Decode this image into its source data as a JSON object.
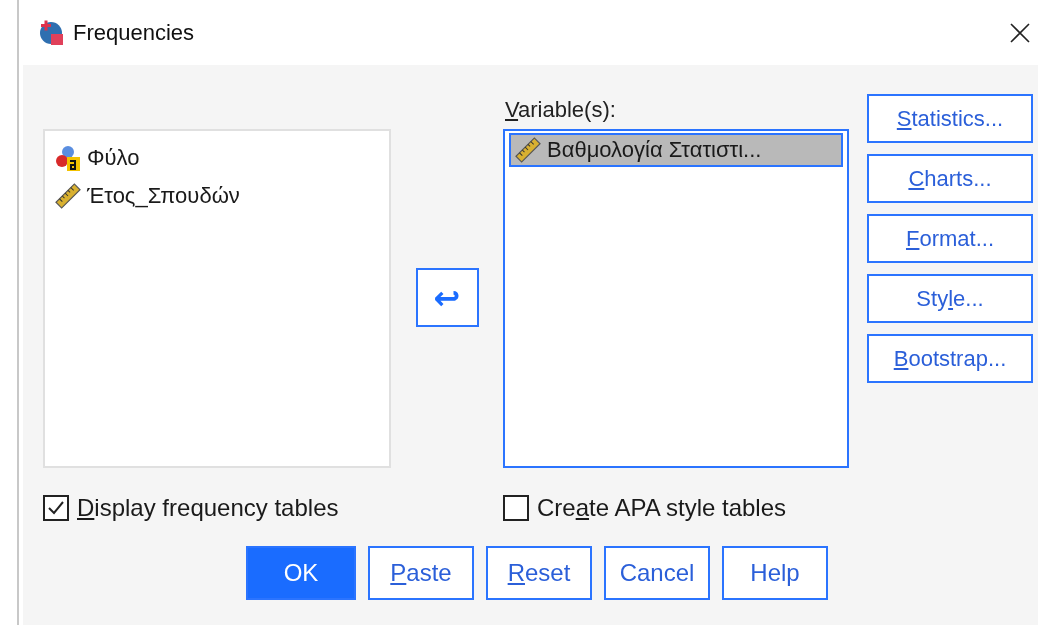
{
  "window": {
    "title": "Frequencies"
  },
  "source_list": {
    "items": [
      {
        "name": "Φύλο",
        "kind": "nominal",
        "selected": false
      },
      {
        "name": "Έτος_Σπουδών",
        "kind": "scale",
        "selected": false
      }
    ]
  },
  "move_button": {
    "symbol": "↩"
  },
  "variables": {
    "label": {
      "key": "V",
      "post": "ariable(s):"
    },
    "items": [
      {
        "name": "Βαθμολογία Στατιστι...",
        "kind": "scale",
        "selected": true
      }
    ]
  },
  "side_buttons": [
    {
      "key": "S",
      "post": "tatistics..."
    },
    {
      "key": "C",
      "post": "harts..."
    },
    {
      "key": "F",
      "post": "ormat..."
    },
    {
      "pre": "Sty",
      "key": "l",
      "post": "e..."
    },
    {
      "key": "B",
      "post": "ootstrap..."
    }
  ],
  "options": [
    {
      "key": "D",
      "post": "isplay frequency tables",
      "checked": true
    },
    {
      "pre": "Cre",
      "key": "a",
      "post": "te APA style tables",
      "checked": false
    }
  ],
  "buttons": [
    {
      "pre": "OK",
      "primary": true
    },
    {
      "key": "P",
      "post": "aste",
      "primary": false
    },
    {
      "key": "R",
      "post": "eset",
      "primary": false
    },
    {
      "pre": "Cancel",
      "primary": false
    },
    {
      "pre": "Help",
      "primary": false
    }
  ]
}
